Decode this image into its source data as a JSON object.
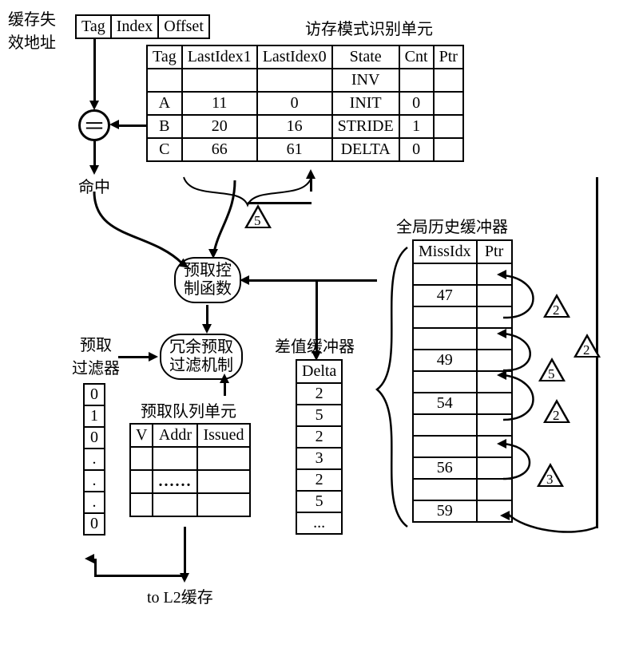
{
  "labels": {
    "cache_miss_addr": "缓存失\n效地址",
    "mem_access_unit": "访存模式识别单元",
    "hit": "命中",
    "prefetch_ctrl": "预取控\n制函数",
    "redundant_filter": "冗余预取\n过滤机制",
    "prefetch_filter": "预取\n过滤器",
    "delta_buffer": "差值缓冲器",
    "ghb": "全局历史缓冲器",
    "prefetch_queue_unit": "预取队列单元",
    "to_l2": "to L2缓存"
  },
  "addr_fields": {
    "tag": "Tag",
    "index": "Index",
    "offset": "Offset"
  },
  "pattern_table": {
    "headers": [
      "Tag",
      "LastIdex1",
      "LastIdex0",
      "State",
      "Cnt",
      "Ptr"
    ],
    "rows": [
      [
        "",
        "",
        "",
        "INV",
        "",
        ""
      ],
      [
        "A",
        "11",
        "0",
        "INIT",
        "0",
        ""
      ],
      [
        "B",
        "20",
        "16",
        "STRIDE",
        "1",
        ""
      ],
      [
        "C",
        "66",
        "61",
        "DELTA",
        "0",
        ""
      ]
    ]
  },
  "diff_delta": "5",
  "ghb_table": {
    "headers": [
      "MissIdx",
      "Ptr"
    ],
    "rows": [
      [
        "",
        ""
      ],
      [
        "47",
        ""
      ],
      [
        "",
        ""
      ],
      [
        "",
        ""
      ],
      [
        "49",
        ""
      ],
      [
        "",
        ""
      ],
      [
        "54",
        ""
      ],
      [
        "",
        ""
      ],
      [
        "",
        ""
      ],
      [
        "56",
        ""
      ],
      [
        "",
        ""
      ],
      [
        "59",
        ""
      ]
    ],
    "annotations": [
      "2",
      "2",
      "5",
      "2",
      "3",
      "2"
    ]
  },
  "delta_table": {
    "header": "Delta",
    "rows": [
      "2",
      "5",
      "2",
      "3",
      "2",
      "5",
      "..."
    ]
  },
  "filter_bits": [
    "0",
    "1",
    "0",
    ".",
    ".",
    ".",
    "0"
  ],
  "queue_table": {
    "headers": [
      "V",
      "Addr",
      "Issued"
    ]
  }
}
